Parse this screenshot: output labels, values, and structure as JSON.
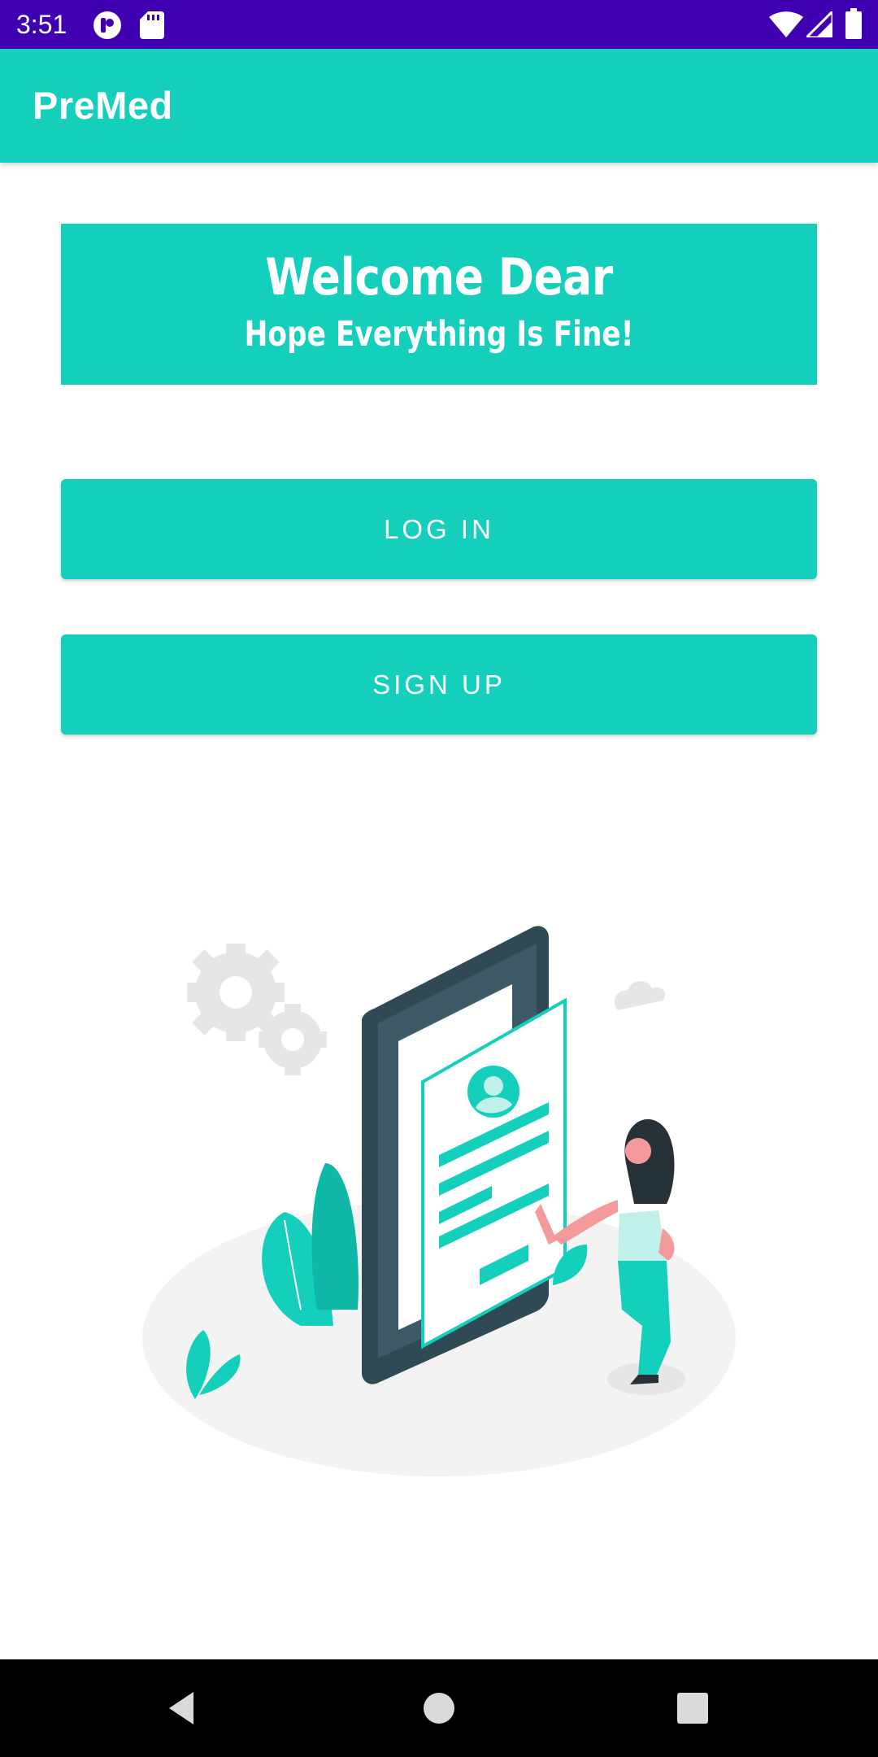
{
  "status_bar": {
    "time": "3:51",
    "icons": [
      "app-notification-icon",
      "sd-card-icon",
      "wifi-icon",
      "cellular-signal-icon",
      "battery-icon"
    ],
    "background": "#3f00b2"
  },
  "app_bar": {
    "title": "PreMed",
    "background": "#14cfbc"
  },
  "welcome": {
    "title": "Welcome Dear",
    "subtitle": "Hope Everything Is Fine!"
  },
  "actions": {
    "login_label": "LOG IN",
    "signup_label": "SIGN UP"
  },
  "illustration": {
    "name": "phone-profile-illustration",
    "accent": "#14cfbc"
  },
  "nav_bar": {
    "icons": [
      "back-icon",
      "home-icon",
      "recents-icon"
    ]
  }
}
